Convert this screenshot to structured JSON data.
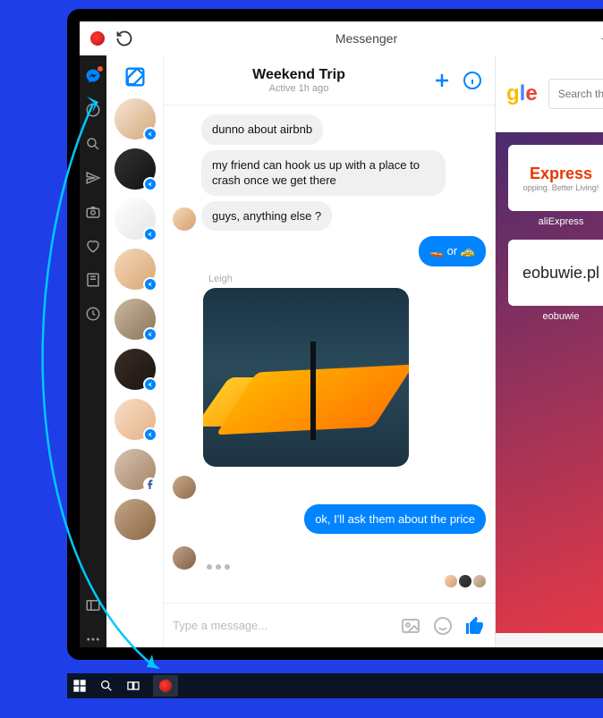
{
  "browser": {
    "title": "Messenger"
  },
  "chat": {
    "title": "Weekend Trip",
    "subtitle": "Active 1h ago",
    "messages": {
      "m1": "dunno about airbnb",
      "m2": "my friend can hook us up with a place to crash once we get there",
      "m3": "guys, anything else ?",
      "m4": "🚤 or 🚕",
      "senderName": "Leigh",
      "m5": "ok, I'll ask them about the price"
    },
    "composerPlaceholder": "Type a message..."
  },
  "background": {
    "searchPlaceholder": "Search the we",
    "tiles": {
      "express": "Express",
      "expressSub": "opping. Better Living!",
      "expressLabel": "aliExpress",
      "obuwie": "eobuwie.pl",
      "obuwieLabel": "eobuwie"
    }
  }
}
